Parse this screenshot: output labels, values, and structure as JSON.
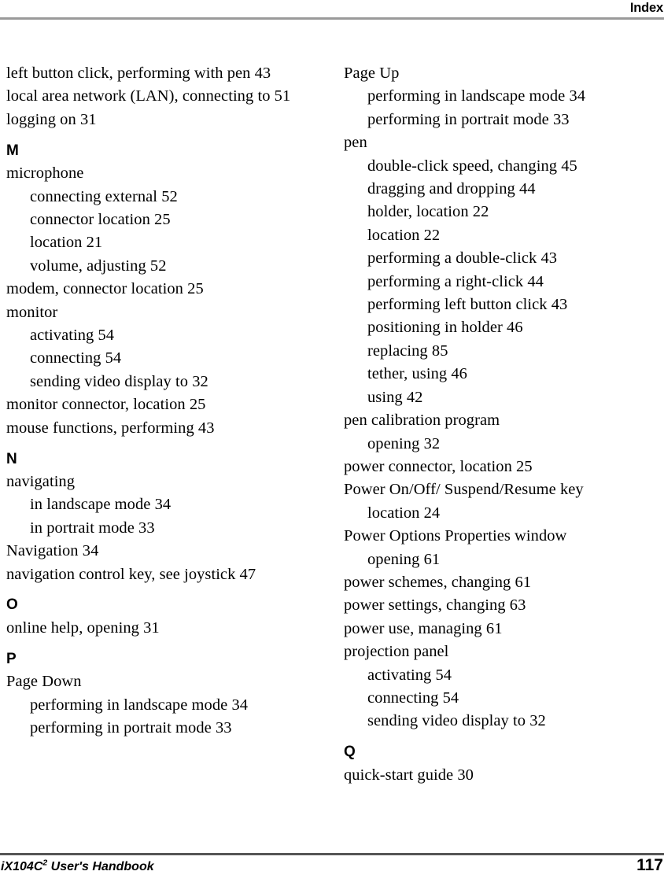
{
  "header": {
    "title": "Index"
  },
  "footer": {
    "book_title": "iX104C",
    "book_title_sup": "2",
    "book_title_rest": " User's Handbook",
    "page_number": "117"
  },
  "columns": [
    {
      "name": "left",
      "groups": [
        {
          "letter": "",
          "entries": [
            {
              "text": "left button click, performing with pen 43",
              "level": 0
            },
            {
              "text": "local area network (LAN), connecting to 51",
              "level": 0
            },
            {
              "text": "logging on 31",
              "level": 0
            }
          ]
        },
        {
          "letter": "M",
          "entries": [
            {
              "text": "microphone",
              "level": 0
            },
            {
              "text": "connecting external 52",
              "level": 1
            },
            {
              "text": "connector location 25",
              "level": 1
            },
            {
              "text": "location 21",
              "level": 1
            },
            {
              "text": "volume, adjusting 52",
              "level": 1
            },
            {
              "text": "modem, connector location 25",
              "level": 0
            },
            {
              "text": "monitor",
              "level": 0
            },
            {
              "text": "activating 54",
              "level": 1
            },
            {
              "text": "connecting 54",
              "level": 1
            },
            {
              "text": "sending video display to 32",
              "level": 1
            },
            {
              "text": "monitor connector, location 25",
              "level": 0
            },
            {
              "text": "mouse functions, performing 43",
              "level": 0
            }
          ]
        },
        {
          "letter": "N",
          "entries": [
            {
              "text": "navigating",
              "level": 0
            },
            {
              "text": "in landscape mode 34",
              "level": 1
            },
            {
              "text": "in portrait mode 33",
              "level": 1
            },
            {
              "text": "Navigation 34",
              "level": 0
            },
            {
              "text": "navigation control key, see joystick 47",
              "level": 0
            }
          ]
        },
        {
          "letter": "O",
          "entries": [
            {
              "text": "online help, opening 31",
              "level": 0
            }
          ]
        },
        {
          "letter": "P",
          "entries": [
            {
              "text": "Page Down",
              "level": 0
            },
            {
              "text": "performing in landscape mode 34",
              "level": 1
            },
            {
              "text": "performing in portrait mode 33",
              "level": 1
            }
          ]
        }
      ]
    },
    {
      "name": "right",
      "groups": [
        {
          "letter": "",
          "entries": [
            {
              "text": "Page Up",
              "level": 0
            },
            {
              "text": "performing in landscape mode 34",
              "level": 1
            },
            {
              "text": "performing in portrait mode 33",
              "level": 1
            },
            {
              "text": "pen",
              "level": 0
            },
            {
              "text": "double-click speed, changing 45",
              "level": 1
            },
            {
              "text": "dragging and dropping 44",
              "level": 1
            },
            {
              "text": "holder, location 22",
              "level": 1
            },
            {
              "text": "location 22",
              "level": 1
            },
            {
              "text": "performing a double-click 43",
              "level": 1
            },
            {
              "text": "performing a right-click 44",
              "level": 1
            },
            {
              "text": "performing left button click 43",
              "level": 1
            },
            {
              "text": "positioning in holder 46",
              "level": 1
            },
            {
              "text": "replacing 85",
              "level": 1
            },
            {
              "text": "tether, using 46",
              "level": 1
            },
            {
              "text": "using 42",
              "level": 1
            },
            {
              "text": "pen calibration program",
              "level": 0
            },
            {
              "text": "opening 32",
              "level": 1
            },
            {
              "text": "power connector, location 25",
              "level": 0
            },
            {
              "text": "Power On/Off/ Suspend/Resume key",
              "level": 0
            },
            {
              "text": "location 24",
              "level": 1
            },
            {
              "text": "Power Options Properties window",
              "level": 0
            },
            {
              "text": "opening 61",
              "level": 1
            },
            {
              "text": "power schemes, changing 61",
              "level": 0
            },
            {
              "text": "power settings, changing 63",
              "level": 0
            },
            {
              "text": "power use, managing 61",
              "level": 0
            },
            {
              "text": "projection panel",
              "level": 0
            },
            {
              "text": "activating 54",
              "level": 1
            },
            {
              "text": "connecting 54",
              "level": 1
            },
            {
              "text": "sending video display to 32",
              "level": 1
            }
          ]
        },
        {
          "letter": "Q",
          "entries": [
            {
              "text": "quick-start guide 30",
              "level": 0
            }
          ]
        }
      ]
    }
  ]
}
